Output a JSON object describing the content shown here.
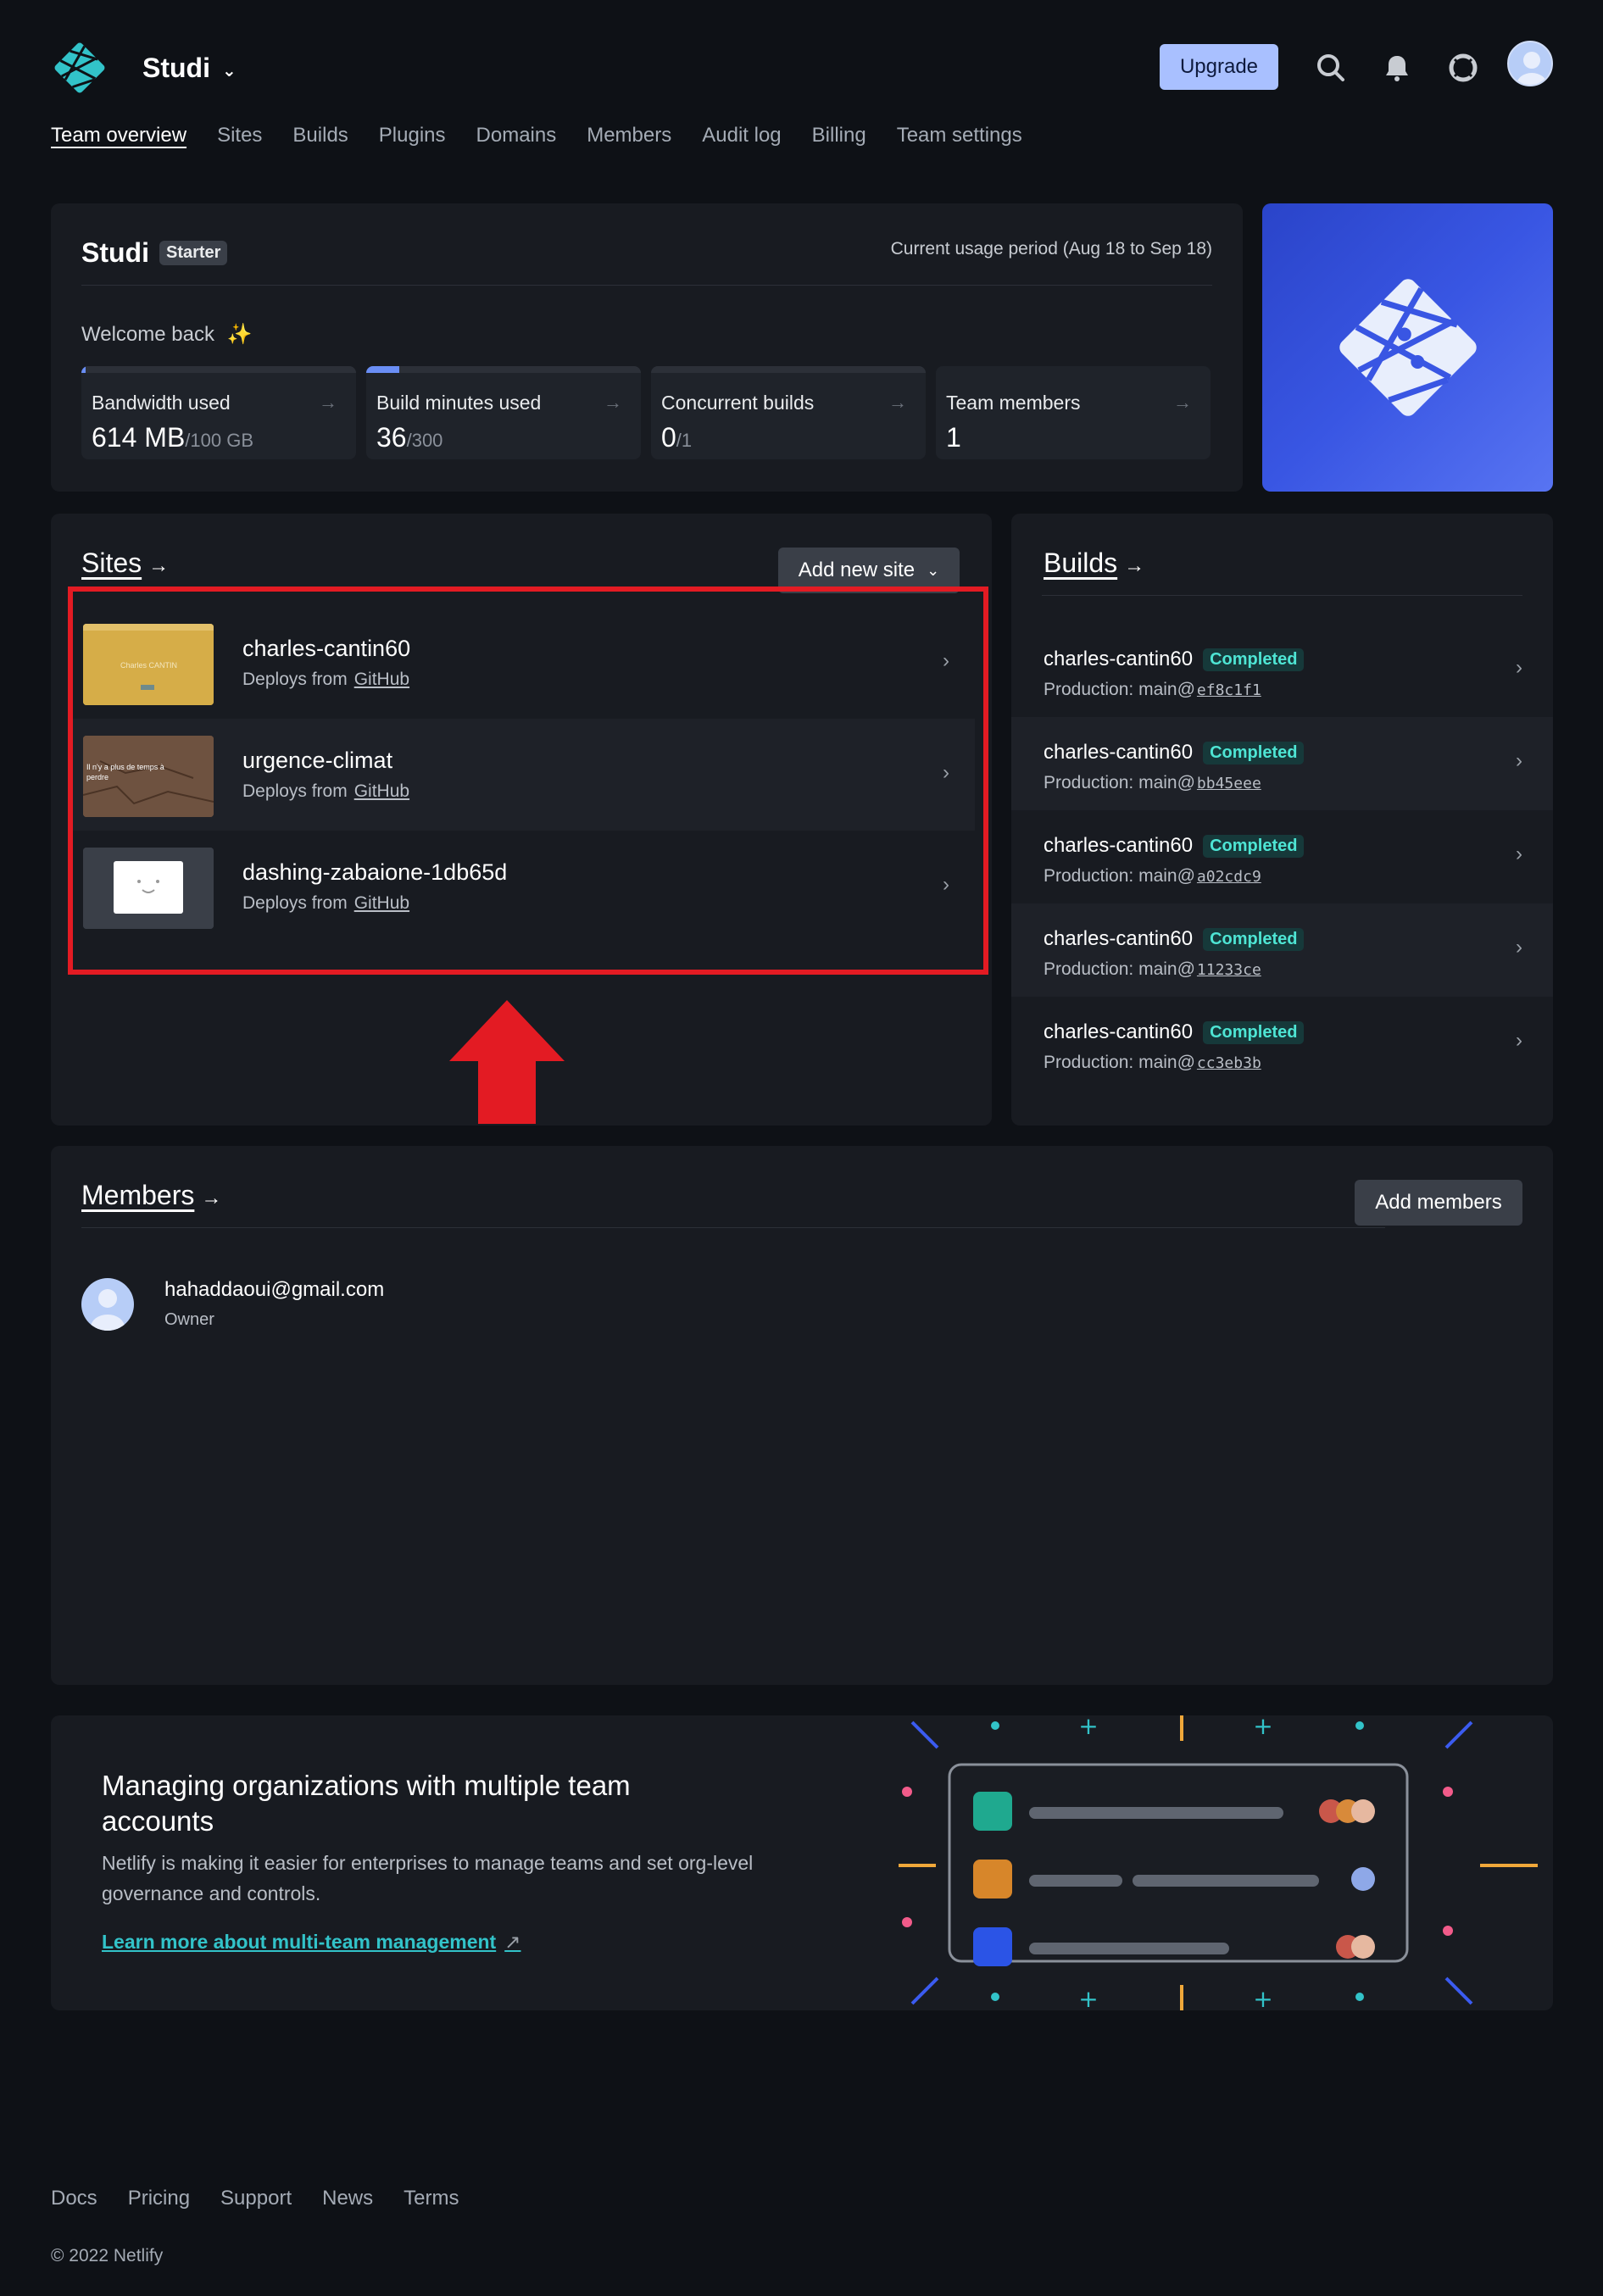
{
  "header": {
    "team_name": "Studi",
    "upgrade_label": "Upgrade",
    "icons": [
      "search-icon",
      "bell-icon",
      "help-icon",
      "avatar"
    ]
  },
  "nav": {
    "items": [
      {
        "label": "Team overview",
        "active": true
      },
      {
        "label": "Sites"
      },
      {
        "label": "Builds"
      },
      {
        "label": "Plugins"
      },
      {
        "label": "Domains"
      },
      {
        "label": "Members"
      },
      {
        "label": "Audit log"
      },
      {
        "label": "Billing"
      },
      {
        "label": "Team settings"
      }
    ]
  },
  "usage": {
    "team_name": "Studi",
    "plan_badge": "Starter",
    "period": "Current usage period (Aug 18 to Sep 18)",
    "welcome": "Welcome back",
    "welcome_icon": "sparkles-icon",
    "stats": [
      {
        "label": "Bandwidth used",
        "value": "614 MB",
        "limit": "/100 GB",
        "progress": 0.006
      },
      {
        "label": "Build minutes used",
        "value": "36",
        "limit": "/300",
        "progress": 0.12
      },
      {
        "label": "Concurrent builds",
        "value": "0",
        "limit": "/1",
        "progress": 0
      },
      {
        "label": "Team members",
        "value": "1",
        "limit": "",
        "progress": null
      }
    ]
  },
  "sites": {
    "title": "Sites",
    "arrow": "→",
    "add_label": "Add new site",
    "items": [
      {
        "name": "charles-cantin60",
        "deploys_prefix": "Deploys from",
        "provider": "GitHub"
      },
      {
        "name": "urgence-climat",
        "deploys_prefix": "Deploys from",
        "provider": "GitHub"
      },
      {
        "name": "dashing-zabaione-1db65d",
        "deploys_prefix": "Deploys from",
        "provider": "GitHub"
      }
    ]
  },
  "builds": {
    "title": "Builds",
    "arrow": "→",
    "items": [
      {
        "site": "charles-cantin60",
        "status": "Completed",
        "context": "Production:",
        "branch": "main@",
        "sha": "ef8c1f1"
      },
      {
        "site": "charles-cantin60",
        "status": "Completed",
        "context": "Production:",
        "branch": "main@",
        "sha": "bb45eee"
      },
      {
        "site": "charles-cantin60",
        "status": "Completed",
        "context": "Production:",
        "branch": "main@",
        "sha": "a02cdc9"
      },
      {
        "site": "charles-cantin60",
        "status": "Completed",
        "context": "Production:",
        "branch": "main@",
        "sha": "11233ce"
      },
      {
        "site": "charles-cantin60",
        "status": "Completed",
        "context": "Production:",
        "branch": "main@",
        "sha": "cc3eb3b"
      }
    ]
  },
  "members": {
    "title": "Members",
    "arrow": "→",
    "add_label": "Add members",
    "items": [
      {
        "email": "hahaddaoui@gmail.com",
        "role": "Owner"
      }
    ]
  },
  "promo": {
    "title": "Managing organizations with multiple team accounts",
    "text": "Netlify is making it easier for enterprises to manage teams and set org-level governance and controls.",
    "link": "Learn more about multi-team management",
    "link_icon": "↗"
  },
  "footer": {
    "links": [
      "Docs",
      "Pricing",
      "Support",
      "News",
      "Terms"
    ],
    "copyright": "© 2022 Netlify"
  },
  "colors": {
    "background": "#0e1116",
    "card": "#181b21",
    "accent": "#a9c0ff",
    "teal": "#32c3c9",
    "highlight": "#e31b23"
  }
}
